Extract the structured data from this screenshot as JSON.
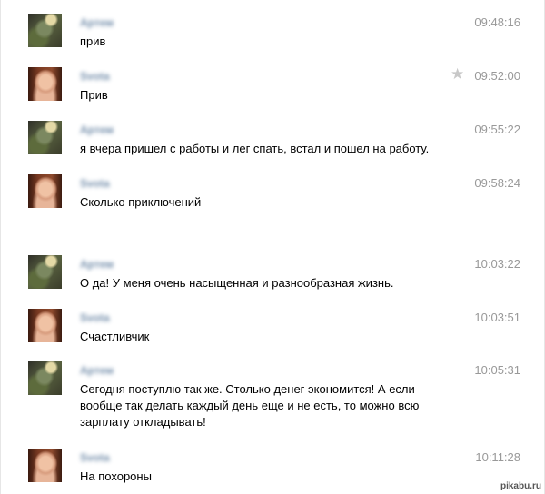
{
  "messages": [
    {
      "sender": "Артем",
      "avatar": "artem",
      "time": "09:48:16",
      "text": "прив",
      "starred": false
    },
    {
      "sender": "Svota",
      "avatar": "svota",
      "time": "09:52:00",
      "text": "Прив",
      "starred": true
    },
    {
      "sender": "Артем",
      "avatar": "artem",
      "time": "09:55:22",
      "text": "я вчера пришел с работы и лег спать, встал и пошел на работу.",
      "starred": false
    },
    {
      "sender": "Svota",
      "avatar": "svota",
      "time": "09:58:24",
      "text": "Сколько приключений",
      "starred": false
    },
    {
      "sender": "Артем",
      "avatar": "artem",
      "time": "10:03:22",
      "text": "О да! У меня очень насыщенная и разнообразная жизнь.",
      "starred": false
    },
    {
      "sender": "Svota",
      "avatar": "svota",
      "time": "10:03:51",
      "text": "Счастливчик",
      "starred": false
    },
    {
      "sender": "Артем",
      "avatar": "artem",
      "time": "10:05:31",
      "text": "Сегодня поступлю так же. Столько денег экономится! А если вообще так делать каждый день еще и не есть, то можно всю зарплату откладывать!",
      "starred": false
    },
    {
      "sender": "Svota",
      "avatar": "svota",
      "time": "10:11:28",
      "text": "На похороны",
      "starred": false
    }
  ],
  "star_icon": "star-icon",
  "watermark": "pikabu.ru"
}
